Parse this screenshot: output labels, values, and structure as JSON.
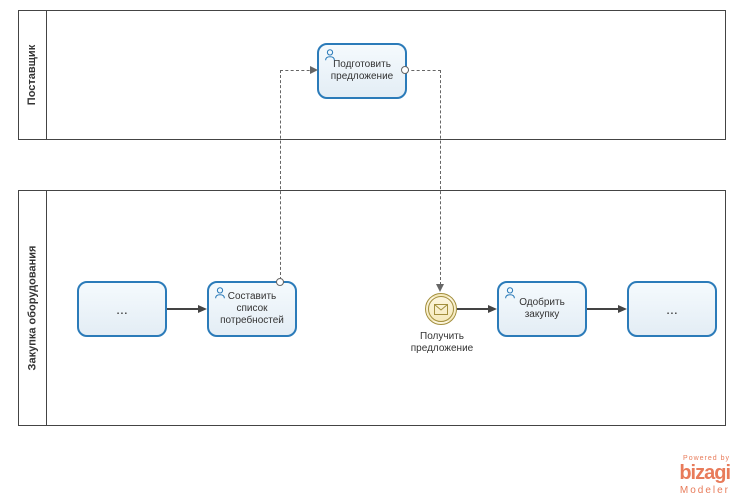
{
  "pool1": {
    "label": "Поставщик"
  },
  "pool2": {
    "label": "Закупка оборудования"
  },
  "tasks": {
    "prepare": "Подготовить предложение",
    "compose": "Составить список потребностей",
    "approve": "Одобрить закупку",
    "collapsed1": "...",
    "collapsed2": "..."
  },
  "event": {
    "label": "Получить предложение"
  },
  "logo": {
    "powered": "Powered by",
    "brand": "bizagi",
    "sub": "Modeler"
  }
}
